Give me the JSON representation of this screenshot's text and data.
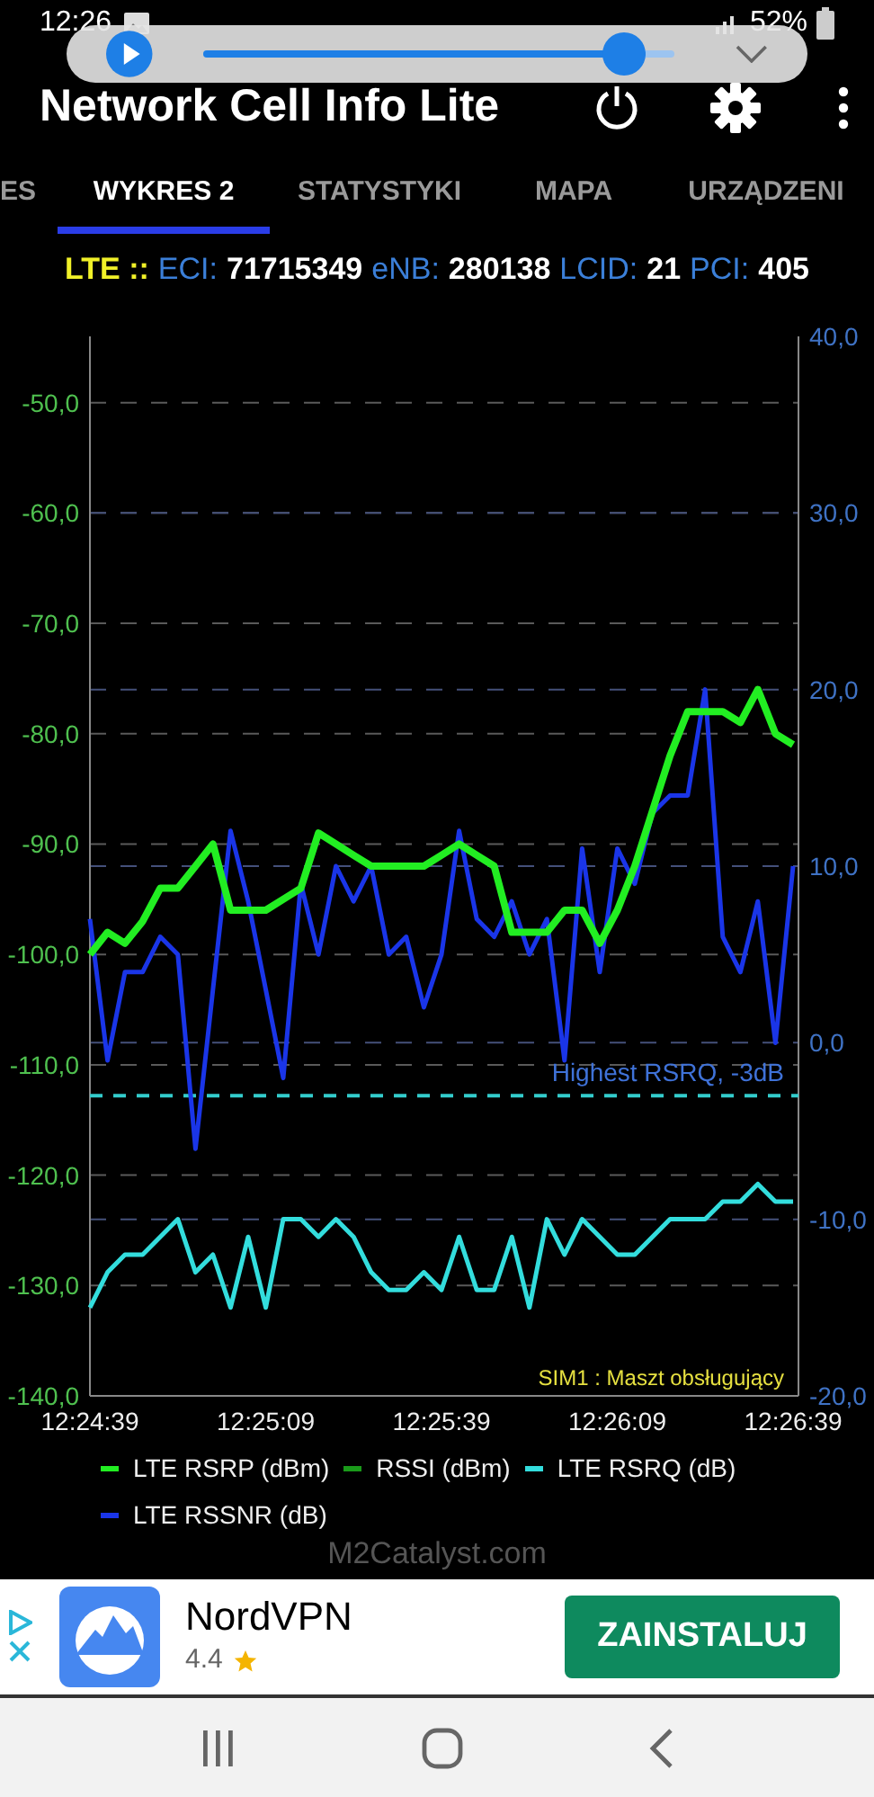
{
  "status_bar": {
    "time": "12:26",
    "battery": "52%"
  },
  "media_overlay": {
    "level": 0.94
  },
  "app_bar": {
    "title": "Network Cell Info Lite"
  },
  "tabs": [
    {
      "label": "ES",
      "selected": false
    },
    {
      "label": "WYKRES 2",
      "selected": true
    },
    {
      "label": "STATYSTYKI",
      "selected": false
    },
    {
      "label": "MAPA",
      "selected": false
    },
    {
      "label": "URZĄDZENI",
      "selected": false
    }
  ],
  "cell_info": [
    {
      "kind": "tech",
      "text": "LTE ::"
    },
    {
      "kind": "label",
      "text": "ECI:"
    },
    {
      "kind": "value",
      "text": "71715349"
    },
    {
      "kind": "label",
      "text": "eNB:"
    },
    {
      "kind": "value",
      "text": "280138"
    },
    {
      "kind": "label",
      "text": "LCID:"
    },
    {
      "kind": "value",
      "text": "21"
    },
    {
      "kind": "label",
      "text": "PCI:"
    },
    {
      "kind": "value",
      "text": "405"
    }
  ],
  "chart_data": {
    "type": "line",
    "categories": [
      "12:24:39",
      null,
      null,
      null,
      null,
      null,
      null,
      null,
      null,
      null,
      "12:25:09",
      null,
      null,
      null,
      null,
      null,
      null,
      null,
      null,
      null,
      "12:25:39",
      null,
      null,
      null,
      null,
      null,
      null,
      null,
      null,
      null,
      "12:26:09",
      null,
      null,
      null,
      null,
      null,
      null,
      null,
      null,
      null,
      "12:26:39"
    ],
    "grid": true,
    "ylim": [
      -140,
      -44
    ],
    "yticks": [
      {
        "value": -50,
        "label": "-50,0"
      },
      {
        "value": -60,
        "label": "-60,0"
      },
      {
        "value": -70,
        "label": "-70,0"
      },
      {
        "value": -80,
        "label": "-80,0"
      },
      {
        "value": -90,
        "label": "-90,0"
      },
      {
        "value": -100,
        "label": "-100,0"
      },
      {
        "value": -110,
        "label": "-110,0"
      },
      {
        "value": -120,
        "label": "-120,0"
      },
      {
        "value": -130,
        "label": "-130,0"
      },
      {
        "value": -140,
        "label": "-140,0"
      }
    ],
    "y2lim": [
      -20,
      40
    ],
    "y2ticks": [
      {
        "value": 40,
        "label": "40,0"
      },
      {
        "value": 30,
        "label": "30,0"
      },
      {
        "value": 20,
        "label": "20,0"
      },
      {
        "value": 10,
        "label": "10,0"
      },
      {
        "value": 0,
        "label": "0,0"
      },
      {
        "value": -10,
        "label": "-10,0"
      },
      {
        "value": -20,
        "label": "-20,0"
      }
    ],
    "series": [
      {
        "name": "LTE RSRP (dBm)",
        "color": "#22ee22",
        "values": [
          -100,
          -98,
          -99,
          -97,
          -94,
          -94,
          -92,
          -90,
          -96,
          -96,
          -96,
          -95,
          -94,
          -89,
          -90,
          -91,
          -92,
          -92,
          -92,
          -92,
          -91,
          -90,
          -91,
          -92,
          -98,
          -98,
          -98,
          -96,
          -96,
          -99,
          -96,
          -92,
          -87,
          -82,
          -78,
          -78,
          -78,
          -79,
          -76,
          -80,
          -81
        ]
      },
      {
        "name": "RSSI (dBm)",
        "color": "#1a9a1a",
        "values": [
          null,
          null,
          null,
          null,
          null,
          null,
          null,
          null,
          null,
          null,
          null,
          null,
          null,
          null,
          null,
          null,
          null,
          null,
          null,
          null,
          null,
          null,
          null,
          null,
          null,
          null,
          null,
          null,
          null,
          null,
          null,
          null,
          null,
          null,
          null,
          null,
          null,
          null,
          null,
          null,
          null
        ]
      },
      {
        "name": "LTE RSRQ (dB)",
        "color": "#33dddd",
        "axis": "y2",
        "values": [
          -15,
          -13,
          -12,
          -12,
          -11,
          -10,
          -13,
          -12,
          -15,
          -11,
          -15,
          -10,
          -10,
          -11,
          -10,
          -11,
          -13,
          -14,
          -14,
          -13,
          -14,
          -11,
          -14,
          -14,
          -11,
          -15,
          -10,
          -12,
          -10,
          -11,
          -12,
          -12,
          -11,
          -10,
          -10,
          -10,
          -9,
          -9,
          -8,
          -9,
          -9
        ]
      },
      {
        "name": "LTE RSSNR (dB)",
        "color": "#1a35e8",
        "axis": "y2",
        "values": [
          7,
          -1,
          4,
          4,
          6,
          5,
          -6,
          3,
          12,
          8,
          3,
          -2,
          9,
          5,
          10,
          8,
          10,
          5,
          6,
          2,
          5,
          12,
          7,
          6,
          8,
          5,
          7,
          -1,
          11,
          4,
          11,
          9,
          13,
          14,
          14,
          20,
          6,
          4,
          8,
          0,
          10
        ]
      }
    ],
    "ref_lines": [
      {
        "value": -3,
        "axis": "y2",
        "label": "Highest RSRQ, -3dB"
      }
    ],
    "annotations": [
      "SIM1 : Maszt obsługujący"
    ]
  },
  "watermark_text": "M2Catalyst.com",
  "ad": {
    "title": "NordVPN",
    "rating": "4.4",
    "button": "ZAINSTALUJ"
  }
}
